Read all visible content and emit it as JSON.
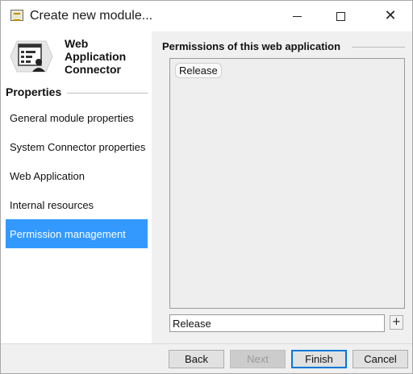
{
  "window": {
    "title": "Create new module...",
    "controls": {
      "minimize": "minimize",
      "maximize": "maximize",
      "close": "✕"
    }
  },
  "module": {
    "title_lines": [
      "Web",
      "Application",
      "Connector"
    ],
    "icon": "web-application-connector-icon"
  },
  "sidebar": {
    "heading": "Properties",
    "items": [
      {
        "label": "General module properties",
        "active": false
      },
      {
        "label": "System Connector properties",
        "active": false
      },
      {
        "label": "Web Application",
        "active": false
      },
      {
        "label": "Internal resources",
        "active": false
      },
      {
        "label": "Permission management",
        "active": true
      }
    ]
  },
  "permissions": {
    "heading": "Permissions of this web application",
    "tags": [
      "Release"
    ],
    "input_value": "Release",
    "add_label": "+"
  },
  "footer": {
    "back": "Back",
    "next": "Next",
    "finish": "Finish",
    "cancel": "Cancel"
  },
  "colors": {
    "accent": "#3399ff",
    "default_button_border": "#0078d7",
    "panel_bg": "#f0f0f0"
  }
}
